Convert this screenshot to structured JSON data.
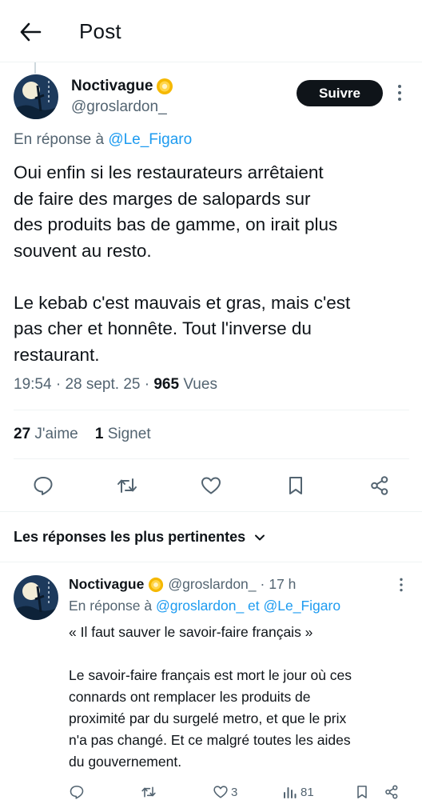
{
  "header": {
    "title": "Post"
  },
  "post": {
    "author_name": "Noctivague",
    "author_handle": "@groslardon_",
    "follow_label": "Suivre",
    "reply_prefix": "En réponse à",
    "reply_mention": "@Le_Figaro",
    "text": "Oui enfin si les restaurateurs arrêtaient\nde faire des marges de salopards sur\ndes produits bas de gamme, on irait plus\nsouvent au resto.\n\nLe kebab c'est mauvais et gras, mais c'est\npas cher et honnête. Tout l'inverse du\nrestaurant.",
    "time": "19:54",
    "date": "28 sept. 25",
    "views_count": "965",
    "views_label": "Vues",
    "likes_count": "27",
    "likes_label": "J'aime",
    "bookmarks_count": "1",
    "bookmarks_label": "Signet"
  },
  "replies_section": {
    "sort_label": "Les réponses les plus pertinentes"
  },
  "reply": {
    "author_name": "Noctivague",
    "author_handle": "@groslardon_",
    "age": "17 h",
    "reply_prefix": "En réponse à",
    "reply_mentions": "@groslardon_ et @Le_Figaro",
    "text": "« Il faut sauver le savoir-faire français »\n\nLe savoir-faire français est mort le jour où ces\nconnards ont remplacer les produits de\nproximité par du surgelé metro, et que le prix\nn'a pas changé. Et ce malgré toutes les aides\ndu gouvernement.",
    "likes": "3",
    "views": "81"
  },
  "icons": {
    "back": "arrow-left-icon",
    "badge": "gold-verified-badge-icon",
    "more": "more-vertical-icon",
    "reply": "reply-bubble-icon",
    "retweet": "retweet-icon",
    "like": "heart-icon",
    "bookmark": "bookmark-icon",
    "share": "share-icon",
    "views": "analytics-bars-icon",
    "sort": "chevron-down-icon"
  },
  "colors": {
    "accent": "#1d9bf0",
    "text": "#0f1419",
    "muted": "#536471",
    "border": "#eff3f4",
    "badge": "#f5b800"
  }
}
